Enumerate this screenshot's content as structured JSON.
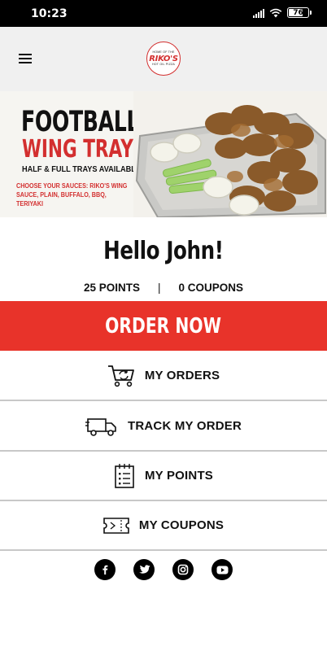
{
  "status_bar": {
    "time": "10:23",
    "signal_icon": "signal-bars-icon",
    "wifi_icon": "wifi-icon",
    "battery_percent": 76,
    "battery_text": "76"
  },
  "header": {
    "menu_icon": "hamburger-menu-icon",
    "logo_text": "RIKO'S",
    "logo_arc_top": "HOME OF THE",
    "logo_arc_bottom": "HOT OIL PIZZA"
  },
  "banner": {
    "line1": "FOOTBALL",
    "line2": "WING TRAYS",
    "subline": "HALF & FULL TRAYS AVAILABLE",
    "sauces": "CHOOSE YOUR SAUCES: RIKO'S WING SAUCE, PLAIN, BUFFALO, BBQ, TERIYAKI"
  },
  "greeting": "Hello John!",
  "stats": {
    "points": "25 POINTS",
    "separator": "|",
    "coupons": "0 COUPONS"
  },
  "order_now_label": "ORDER NOW",
  "menu": [
    {
      "label": "MY ORDERS",
      "icon": "shopping-cart-icon"
    },
    {
      "label": "TRACK MY ORDER",
      "icon": "delivery-truck-icon"
    },
    {
      "label": "MY POINTS",
      "icon": "notepad-list-icon"
    },
    {
      "label": "MY COUPONS",
      "icon": "ticket-icon"
    }
  ],
  "social": [
    {
      "name": "facebook",
      "icon": "facebook-icon"
    },
    {
      "name": "twitter",
      "icon": "twitter-icon"
    },
    {
      "name": "instagram",
      "icon": "instagram-icon"
    },
    {
      "name": "youtube",
      "icon": "youtube-icon"
    }
  ],
  "colors": {
    "brand_red": "#e8332a",
    "logo_red": "#d32f2f",
    "header_bg": "#f0f0f0",
    "divider": "#c8c8c8"
  }
}
